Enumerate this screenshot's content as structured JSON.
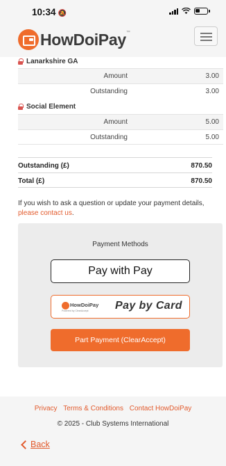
{
  "status_bar": {
    "time": "10:34",
    "icons": [
      "bell-slash-icon",
      "cellular-signal-icon",
      "wifi-icon",
      "battery-icon"
    ]
  },
  "header": {
    "brand": "HowDoiPay",
    "trademark": "™",
    "menu_icon": "hamburger-menu-icon"
  },
  "groups": [
    {
      "name": "Lanarkshire GA",
      "rows": [
        {
          "label": "Amount",
          "value": "3.00"
        },
        {
          "label": "Outstanding",
          "value": "3.00"
        }
      ]
    },
    {
      "name": "Social Element",
      "rows": [
        {
          "label": "Amount",
          "value": "5.00"
        },
        {
          "label": "Outstanding",
          "value": "5.00"
        }
      ]
    }
  ],
  "totals": [
    {
      "label": "Outstanding (£)",
      "value": "870.50"
    },
    {
      "label": "Total (£)",
      "value": "870.50"
    }
  ],
  "contact": {
    "text": "If you wish to ask a question or update your payment details,",
    "link": "please contact us",
    "suffix": "."
  },
  "payment": {
    "title": "Payment Methods",
    "apple_pay_prefix": "Pay with",
    "apple_logo": "",
    "apple_pay_suffix": "Pay",
    "card_brand": "HowDoiPay",
    "card_powered": "Powered by ClearAccept",
    "card_label": "Pay by Card",
    "part_payment": "Part Payment (ClearAccept)"
  },
  "footer": {
    "links": [
      "Privacy",
      "Terms & Conditions",
      "Contact HowDoiPay"
    ],
    "copyright": "© 2025 - Club Systems International",
    "back": "Back"
  },
  "colors": {
    "accent": "#ef6c2c",
    "link": "#e25a2c",
    "lock": "#d9534f",
    "panel": "#ececec"
  }
}
